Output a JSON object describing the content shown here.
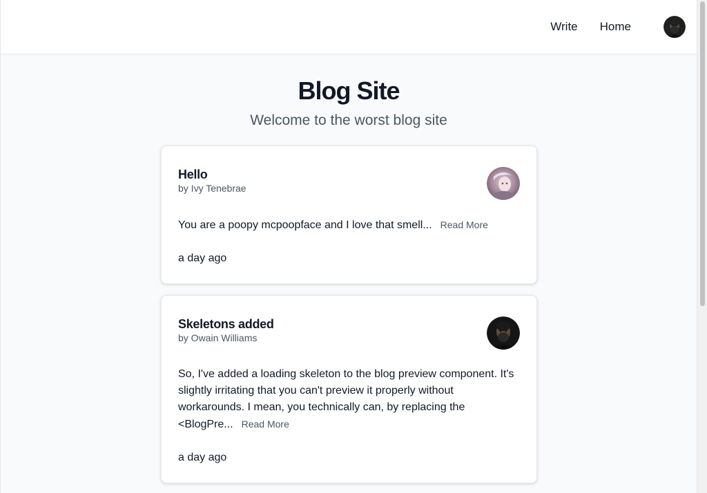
{
  "nav": {
    "write_label": "Write",
    "home_label": "Home"
  },
  "hero": {
    "title": "Blog Site",
    "subtitle": "Welcome to the worst blog site"
  },
  "posts": [
    {
      "title": "Hello",
      "author": "by Ivy Tenebrae",
      "excerpt": "You are a poopy mcpoopface and I love that smell...",
      "read_more": "Read More",
      "time": "a day ago"
    },
    {
      "title": "Skeletons added",
      "author": "by Owain Williams",
      "excerpt": "So, I've added a loading skeleton to the blog preview component. It's slightly irritating that you can't preview it properly without workarounds. I mean, you technically can, by replacing the <BlogPre...",
      "read_more": "Read More",
      "time": "a day ago"
    }
  ]
}
